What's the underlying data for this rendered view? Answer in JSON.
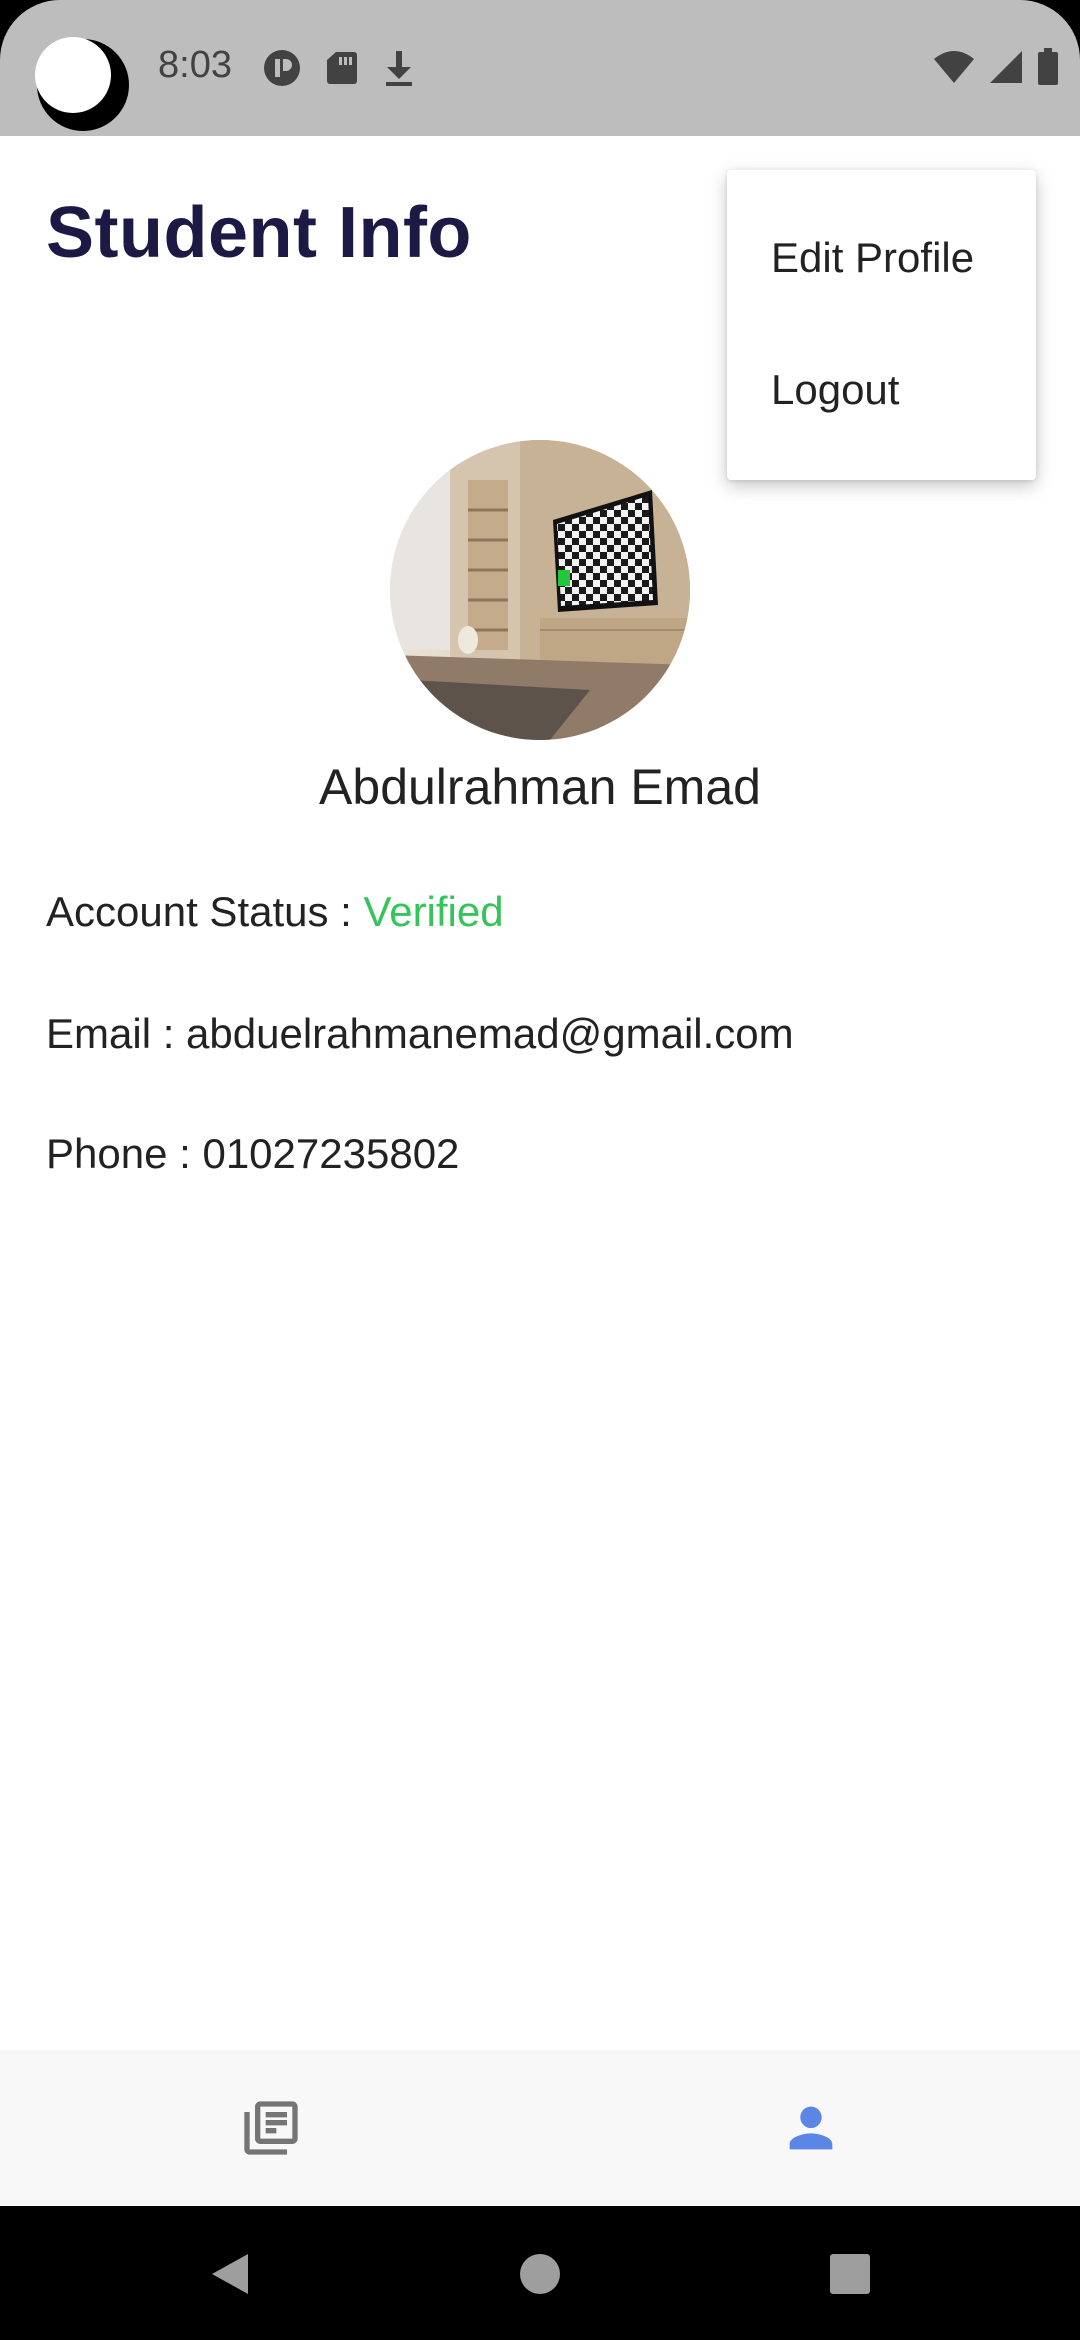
{
  "status_bar": {
    "time": "8:03",
    "icons_left": [
      "moon-icon",
      "p-app-icon",
      "sd-card-icon",
      "download-icon"
    ],
    "icons_right": [
      "wifi-icon",
      "cell-signal-icon",
      "battery-icon"
    ]
  },
  "page": {
    "title": "Student Info"
  },
  "profile": {
    "avatar": "living-room-photo",
    "name": "Abdulrahman Emad",
    "status_label": "Account Status : ",
    "status_value": "Verified",
    "status_color": "#33c45a",
    "email_label": "Email : ",
    "email_value": "abduelrahmanemad@gmail.com",
    "phone_label": "Phone : ",
    "phone_value": "01027235802"
  },
  "menu": {
    "items": [
      {
        "label": "Edit Profile"
      },
      {
        "label": "Logout"
      }
    ]
  },
  "bottom_nav": {
    "items": [
      {
        "icon": "library-books-icon",
        "active": false
      },
      {
        "icon": "person-icon",
        "active": true
      }
    ],
    "active_color": "#5b86e5",
    "inactive_color": "#757575"
  },
  "system_nav": {
    "buttons": [
      "back-icon",
      "home-icon",
      "recents-icon"
    ]
  },
  "colors": {
    "title": "#1c1a45",
    "status_bar": "#bdbdbd"
  }
}
